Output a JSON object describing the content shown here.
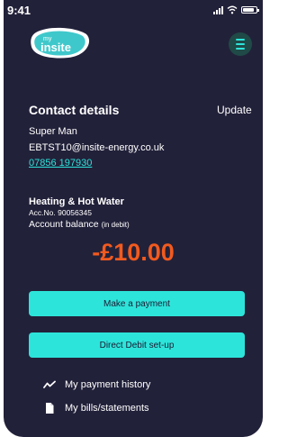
{
  "status_bar": {
    "time": "9:41",
    "icons": [
      "signal-icon",
      "wifi-icon",
      "battery-icon"
    ]
  },
  "header": {
    "logo": {
      "small_text": "my",
      "brand_text": "insite"
    },
    "menu_icon": "hamburger-menu-icon"
  },
  "contact": {
    "title": "Contact details",
    "update_label": "Update",
    "name": "Super Man",
    "email": "EBTST10@insite-energy.co.uk",
    "phone": "07856 197930"
  },
  "account": {
    "title": "Heating & Hot Water",
    "number": "Acc.No. 90056345",
    "balance_label": "Account balance",
    "balance_note": "(in debit)",
    "balance_value": "-£10.00"
  },
  "actions": {
    "make_payment": "Make a payment",
    "direct_debit": "Direct Debit set-up"
  },
  "links": {
    "payment_history": {
      "label": "My payment history",
      "icon": "trend-line-icon"
    },
    "bills": {
      "label": "My bills/statements",
      "icon": "document-icon"
    }
  },
  "colors": {
    "background": "#22213a",
    "accent": "#2de4da",
    "balance": "#f25a1e",
    "text": "#ffffff"
  }
}
